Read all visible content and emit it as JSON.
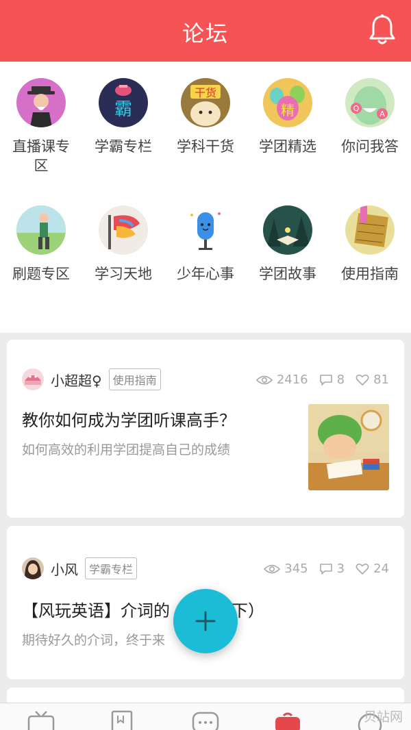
{
  "header": {
    "title": "论坛"
  },
  "categories": [
    {
      "label": "直播课专区",
      "icon": "live-course-icon"
    },
    {
      "label": "学霸专栏",
      "icon": "top-student-icon"
    },
    {
      "label": "学科干货",
      "icon": "subject-tips-icon"
    },
    {
      "label": "学团精选",
      "icon": "featured-icon"
    },
    {
      "label": "你问我答",
      "icon": "qa-icon"
    },
    {
      "label": "刷题专区",
      "icon": "practice-icon"
    },
    {
      "label": "学习天地",
      "icon": "study-world-icon"
    },
    {
      "label": "少年心事",
      "icon": "youth-thoughts-icon"
    },
    {
      "label": "学团故事",
      "icon": "stories-icon"
    },
    {
      "label": "使用指南",
      "icon": "guide-icon"
    }
  ],
  "posts": [
    {
      "author": "小超超♀",
      "tag": "使用指南",
      "views": "2416",
      "comments": "8",
      "likes": "81",
      "title": "教你如何成为学团听课高手？",
      "subtitle": "如何高效的利用学团提高自己的成绩"
    },
    {
      "author": "小风",
      "tag": "学霸专栏",
      "views": "345",
      "comments": "3",
      "likes": "24",
      "title": "【风玩英语】介词的",
      "title_tail": "（下）",
      "subtitle": "期待好久的介词，终于来"
    }
  ],
  "tabs": [
    {
      "icon": "tv-icon"
    },
    {
      "icon": "book-icon"
    },
    {
      "icon": "chat-icon"
    },
    {
      "icon": "forum-cup-icon",
      "active": true
    },
    {
      "icon": "profile-icon"
    }
  ],
  "watermark": "贝站网",
  "colors": {
    "brand": "#f65454",
    "fab": "#1bbcd6"
  }
}
